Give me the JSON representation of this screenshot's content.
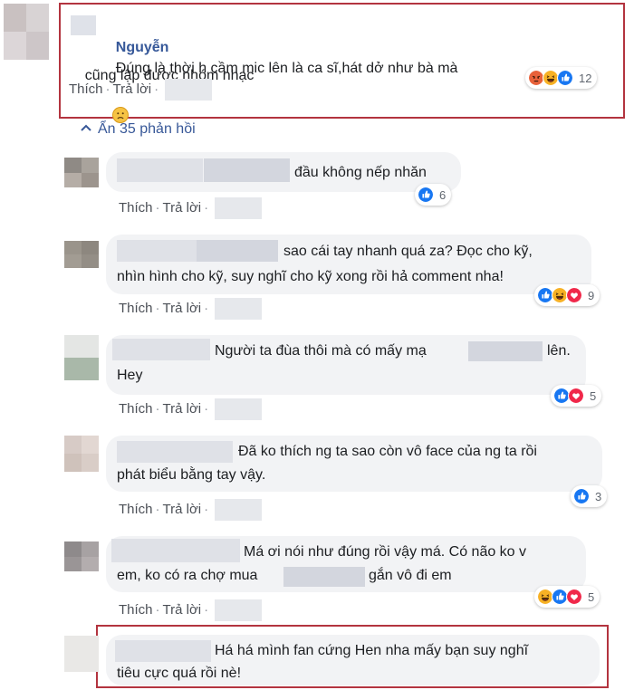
{
  "top_comment": {
    "author": "Nguyễn",
    "line1": "Đúng là thời h cầm mic lên là ca sĩ,hát dở như bà mà",
    "line2": "cũng lập được nhóm nhạc",
    "emoji_icon": "sad-face-icon",
    "actions": {
      "like": "Thích",
      "reply": "Trả lời"
    },
    "reaction_icons": [
      "angry-icon",
      "haha-icon",
      "like-icon"
    ],
    "reaction_count": "12"
  },
  "hide_replies": {
    "icon": "chevron-up-icon",
    "label": "Ẩn 35 phản hồi"
  },
  "replies": [
    {
      "line1": "đầu không nếp nhăn",
      "line2": "",
      "reaction_icons": [
        "like-icon"
      ],
      "reaction_count": "6"
    },
    {
      "line1": "sao cái tay nhanh quá za? Đọc cho kỹ,",
      "line2": "nhìn hình cho kỹ, suy nghĩ cho kỹ xong rồi hả comment nha!",
      "reaction_icons": [
        "like-icon",
        "haha-icon",
        "heart-icon"
      ],
      "reaction_count": "9"
    },
    {
      "line1": "Người ta đùa thôi mà có mấy mạ",
      "line1b": "lên.",
      "line2": "Hey",
      "reaction_icons": [
        "like-icon",
        "heart-icon"
      ],
      "reaction_count": "5"
    },
    {
      "line1": "Đã ko thích ng ta sao còn vô face của ng ta rồi",
      "line2": "phát biểu bằng tay vậy.",
      "reaction_icons": [
        "like-icon"
      ],
      "reaction_count": "3"
    },
    {
      "line1": "Má ơi nói như đúng rồi vậy má. Có não ko v",
      "line2": "em, ko có ra chợ mua",
      "line2b": "gắn vô đi em",
      "reaction_icons": [
        "haha-icon",
        "like-icon",
        "heart-icon"
      ],
      "reaction_count": "5"
    },
    {
      "line1": "Há há mình fan cứng Hen nha mấy bạn suy nghĩ",
      "line2": "tiêu cực quá rồi nè!"
    }
  ],
  "reply_actions": {
    "like": "Thích",
    "reply": "Trả lời"
  },
  "colors": {
    "link_blue": "#365899",
    "highlight_red": "#b3343f",
    "bubble_bg": "#f2f3f5",
    "like_blue": "#1877f2",
    "heart_red": "#f0284a",
    "haha_yellow": "#f7b125"
  }
}
